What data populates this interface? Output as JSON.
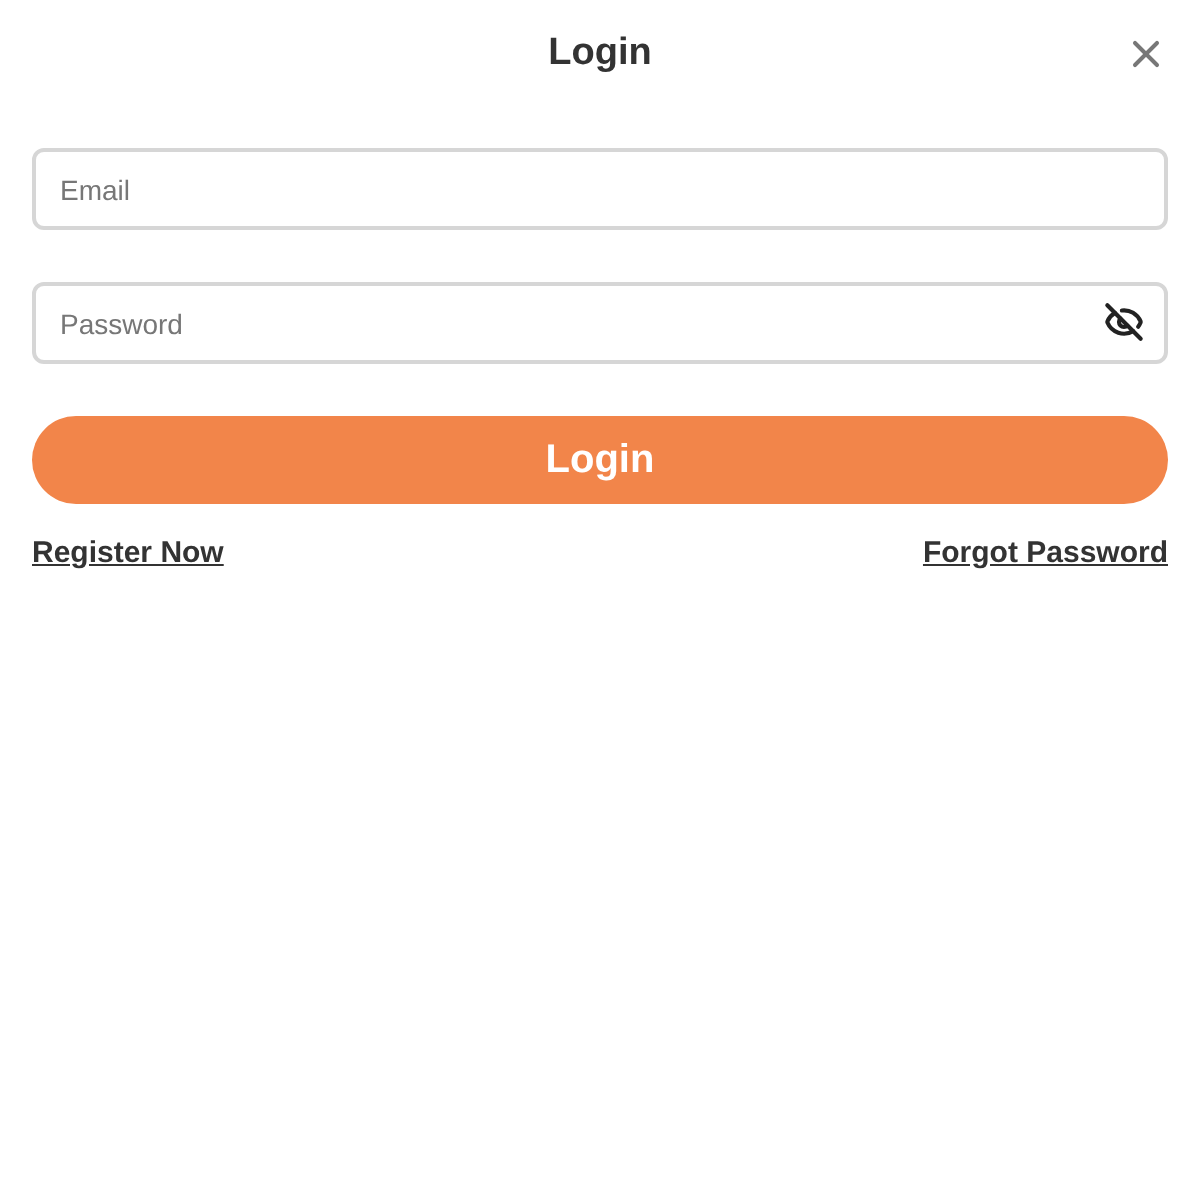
{
  "dialog": {
    "title": "Login"
  },
  "fields": [
    {
      "kind": "email",
      "placeholder": "Email"
    },
    {
      "kind": "password",
      "placeholder": "Password",
      "visible": false
    }
  ],
  "submit": {
    "label": "Login"
  },
  "links": [
    "Register Now",
    "Forgot Password"
  ]
}
